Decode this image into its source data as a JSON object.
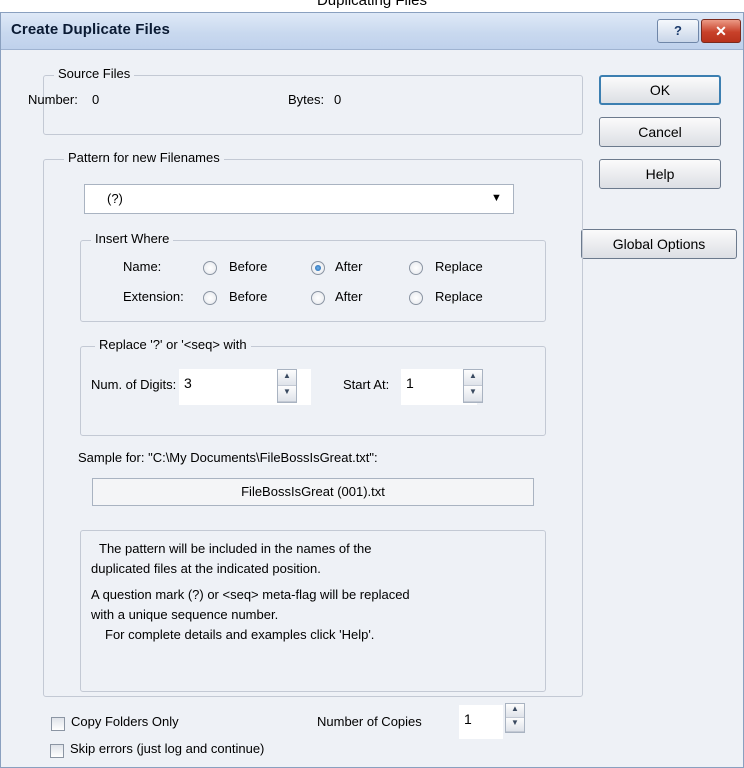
{
  "page": {
    "heading": "Duplicating Files"
  },
  "dialog": {
    "title": "Create Duplicate Files",
    "title_buttons": {
      "help": "?",
      "close": "✕"
    },
    "source_files": {
      "legend": "Source Files",
      "number_label": "Number:",
      "number_value": "0",
      "bytes_label": "Bytes:",
      "bytes_value": "0"
    },
    "buttons": {
      "ok": "OK",
      "cancel": "Cancel",
      "help": "Help",
      "global_options": "Global Options"
    },
    "pattern": {
      "legend": "Pattern for new Filenames",
      "value": "(?)",
      "arrow": "▼"
    },
    "insert_where": {
      "legend": "Insert Where",
      "name_label": "Name:",
      "extension_label": "Extension:",
      "options": [
        "Before",
        "After",
        "Replace"
      ],
      "name_selected": "After",
      "extension_selected": ""
    },
    "replace_with": {
      "legend": "Replace '?' or '<seq> with",
      "digits_label": "Num. of Digits:",
      "digits_value": "3",
      "start_label": "Start At:",
      "start_value": "1"
    },
    "sample": {
      "label": "Sample for: \"C:\\My Documents\\FileBossIsGreat.txt\":",
      "value": "FileBossIsGreat (001).txt"
    },
    "info": {
      "line1": "The pattern will be included in the names of the",
      "line2": "duplicated files at the indicated position.",
      "line3": "A question mark (?) or <seq> meta-flag will be replaced",
      "line4": "with a unique sequence number.",
      "line5": "For complete details and examples click 'Help'."
    },
    "bottom": {
      "copy_folders_only": "Copy Folders Only",
      "copy_folders_checked": false,
      "skip_errors": "Skip errors (just log and continue)",
      "skip_errors_checked": false,
      "copies_label": "Number of Copies",
      "copies_value": "1"
    },
    "spin": {
      "up": "▲",
      "down": "▼"
    }
  }
}
